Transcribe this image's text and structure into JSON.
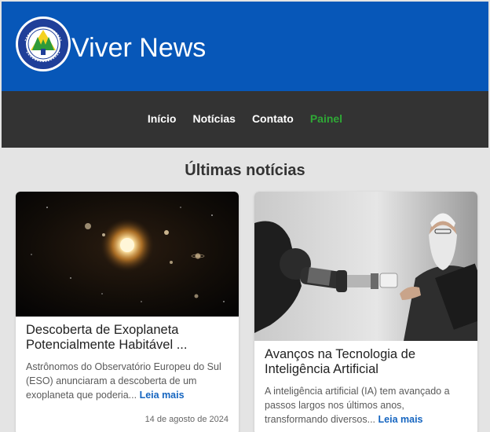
{
  "header": {
    "site_title": "Viver News",
    "logo_text_top": "RESIDENCIAL VIVER",
    "logo_text_bottom": "CAMBÉ - PR"
  },
  "nav": {
    "items": [
      {
        "label": "Início",
        "active": false
      },
      {
        "label": "Notícias",
        "active": false
      },
      {
        "label": "Contato",
        "active": false
      },
      {
        "label": "Painel",
        "active": true
      }
    ]
  },
  "main": {
    "section_title": "Últimas notícias",
    "articles": [
      {
        "title": "Descoberta de Exoplaneta Potencialmente Habitável ...",
        "excerpt": "Astrônomos do Observatório Europeu do Sul (ESO) anunciaram a descoberta de um exoplaneta que poderia...",
        "read_more": "Leia mais",
        "date": "14 de agosto de 2024",
        "image": "space-planets-image"
      },
      {
        "title": "Avanços na Tecnologia de Inteligência Artificial",
        "excerpt": "A inteligência artificial (IA) tem avançado a passos largos nos últimos anos, transformando diversos...",
        "read_more": "Leia mais",
        "image": "robot-arm-elder-man-image"
      }
    ]
  },
  "colors": {
    "header_bg": "#0757b8",
    "nav_bg": "#333333",
    "active_nav": "#2fa836",
    "link": "#1565c0"
  }
}
